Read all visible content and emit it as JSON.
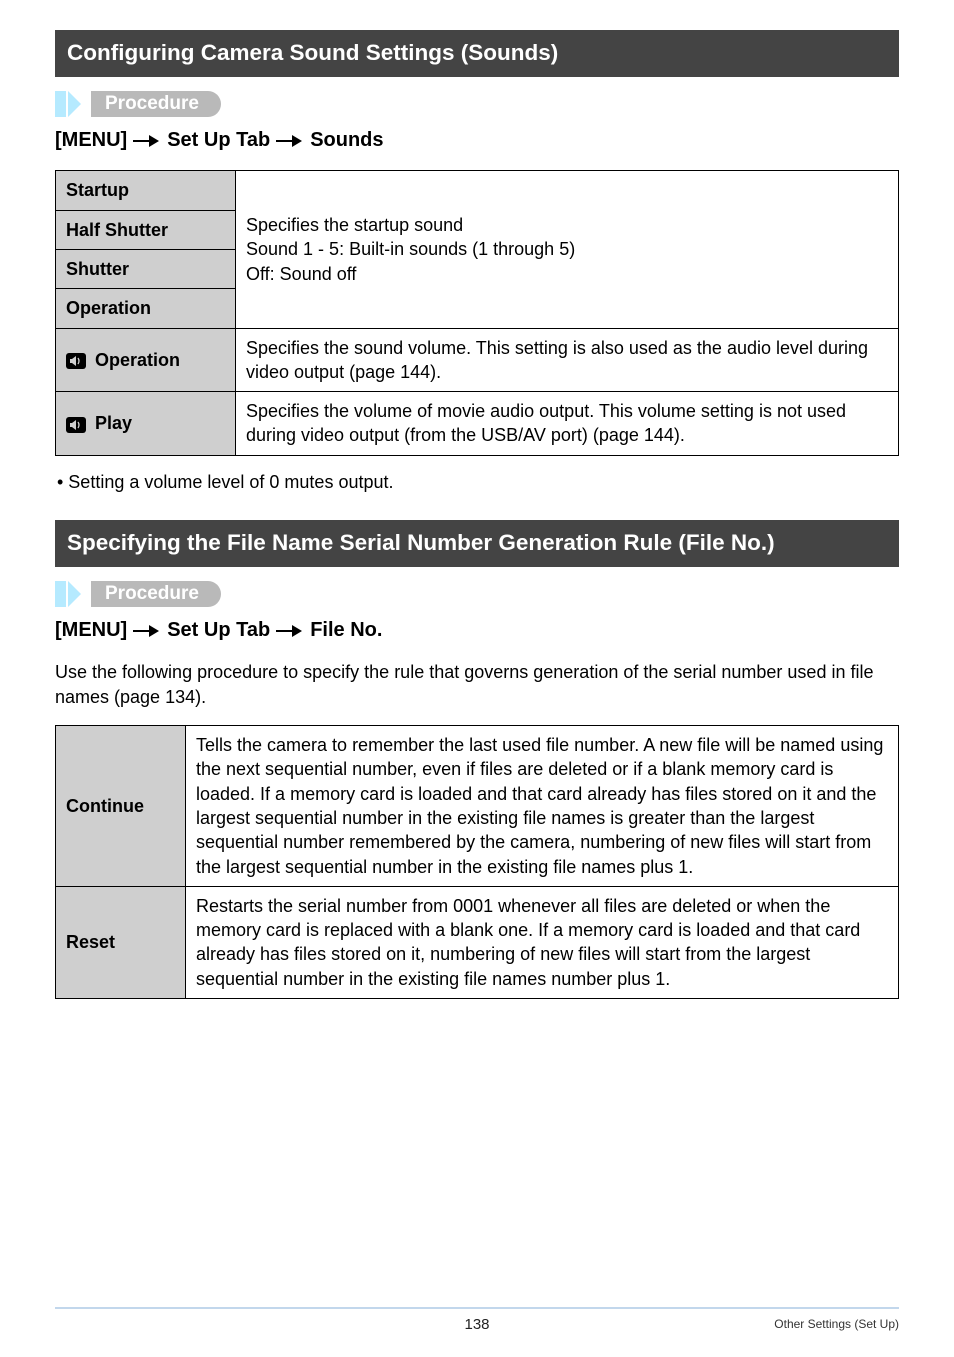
{
  "soundsSection": {
    "title": "Configuring Camera Sound Settings (Sounds)",
    "procedureLabel": "Procedure",
    "menuPath": [
      "[MENU]",
      "Set Up Tab",
      "Sounds"
    ],
    "rows": {
      "startup": "Startup",
      "halfShutter": "Half Shutter",
      "shutter": "Shutter",
      "operation": "Operation",
      "mergedDesc": "Specifies the startup sound\nSound 1 - 5: Built-in sounds (1 through 5)\nOff: Sound off",
      "volOperationLabel": "Operation",
      "volOperationDesc": "Specifies the sound volume. This setting is also used as the audio level during video output (page 144).",
      "volPlayLabel": "Play",
      "volPlayDesc": "Specifies the volume of movie audio output. This volume setting is not used during video output (from the USB/AV port) (page 144)."
    },
    "note": "• Setting a volume level of 0 mutes output."
  },
  "fileNoSection": {
    "title": "Specifying the File Name Serial Number Generation Rule (File No.)",
    "procedureLabel": "Procedure",
    "menuPath": [
      "[MENU]",
      "Set Up Tab",
      "File No."
    ],
    "intro": "Use the following procedure to specify the rule that governs generation of the serial number used in file names (page 134).",
    "rows": {
      "continueLabel": "Continue",
      "continueDesc": "Tells the camera to remember the last used file number. A new file will be named using the next sequential number, even if files are deleted or if a blank memory card is loaded. If a memory card is loaded and that card already has files stored on it and the largest sequential number in the existing file names is greater than the largest sequential number remembered by the camera, numbering of new files will start from the largest sequential number in the existing file names plus 1.",
      "resetLabel": "Reset",
      "resetDesc": "Restarts the serial number from 0001 whenever all files are deleted or when the memory card is replaced with a blank one. If a memory card is loaded and that card already has files stored on it, numbering of new files will start from the largest sequential number in the existing file names number plus 1."
    }
  },
  "footer": {
    "pageNumber": "138",
    "sectionName": "Other Settings (Set Up)"
  }
}
